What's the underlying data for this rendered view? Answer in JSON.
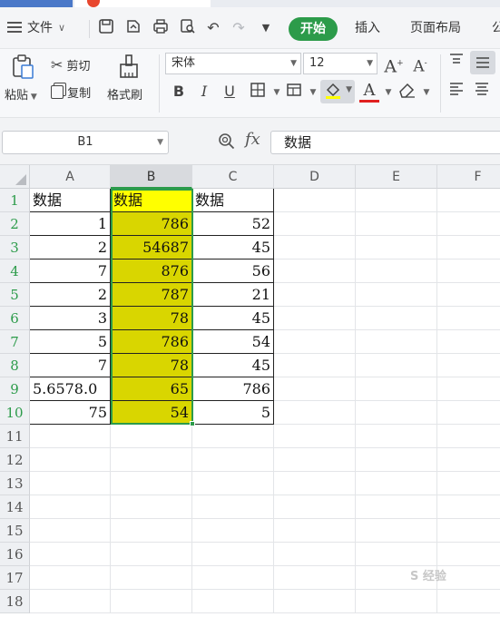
{
  "menu": {
    "file_label": "文件",
    "tabs": {
      "start": "开始",
      "insert": "插入",
      "page_layout": "页面布局",
      "formula_partial": "公"
    }
  },
  "ribbon": {
    "paste": "粘贴",
    "cut": "剪切",
    "copy": "复制",
    "format_painter": "格式刷",
    "font_name": "宋体",
    "font_size": "12",
    "bold": "B",
    "italic": "I",
    "underline": "U",
    "font_color_glyph": "A",
    "grow_font_glyph": "A",
    "shrink_font_glyph": "A"
  },
  "formula_bar": {
    "name_box": "B1",
    "fx_label": "fx",
    "content": "数据"
  },
  "grid": {
    "columns": [
      "A",
      "B",
      "C",
      "D",
      "E",
      "F"
    ],
    "rows": [
      "1",
      "2",
      "3",
      "4",
      "5",
      "6",
      "7",
      "8",
      "9",
      "10",
      "11",
      "12",
      "13",
      "14",
      "15",
      "16",
      "17",
      "18"
    ],
    "data": [
      [
        "数据",
        "数据",
        "数据"
      ],
      [
        "1",
        "786",
        "52"
      ],
      [
        "2",
        "54687",
        "45"
      ],
      [
        "7",
        "876",
        "56"
      ],
      [
        "2",
        "787",
        "21"
      ],
      [
        "3",
        "78",
        "45"
      ],
      [
        "5",
        "786",
        "54"
      ],
      [
        "7",
        "78",
        "45"
      ],
      [
        "5.6578.0",
        "65",
        "786"
      ],
      [
        "75",
        "54",
        "5"
      ]
    ]
  },
  "colors": {
    "accent_green": "#2c9b4a",
    "highlight_yellow": "#ffff00",
    "highlight_olive": "#d9d600"
  }
}
